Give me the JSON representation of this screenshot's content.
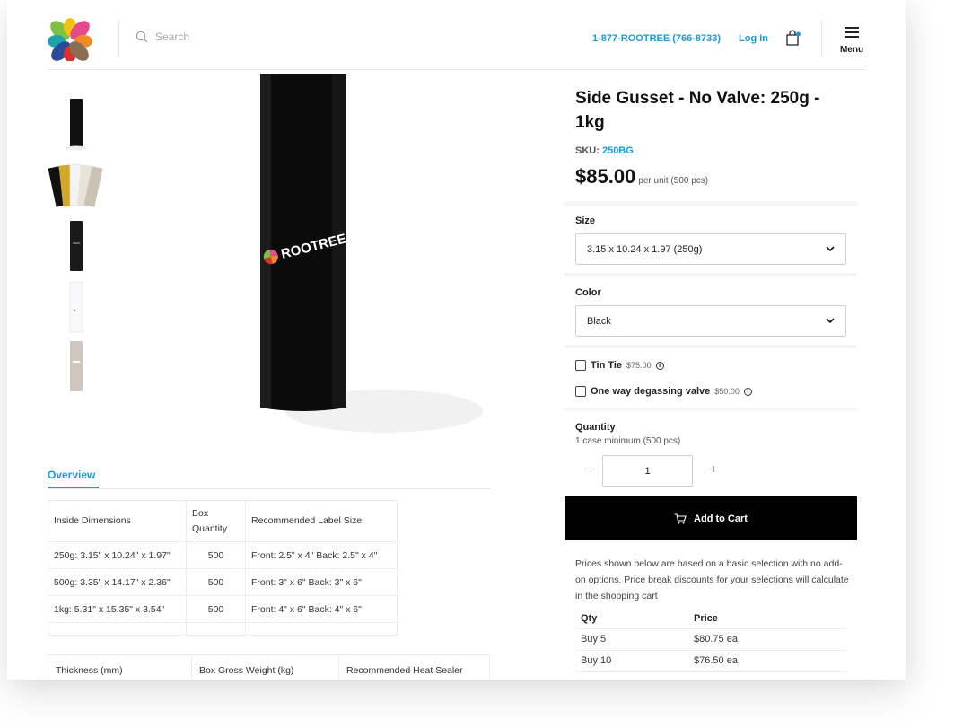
{
  "header": {
    "search_placeholder": "Search",
    "phone": "1-877-ROOTREE (766-8733)",
    "login": "Log In",
    "menu_label": "Menu"
  },
  "product": {
    "brand_on_bag": "ROOTREE",
    "title": "Side Gusset - No Valve: 250g - 1kg",
    "sku_label": "SKU:",
    "sku": "250BG",
    "price": "$85.00",
    "price_unit": "per unit (500 pcs)",
    "size_label": "Size",
    "size_value": "3.15 x 10.24 x 1.97 (250g)",
    "color_label": "Color",
    "color_value": "Black",
    "addons": [
      {
        "name": "Tin Tie",
        "price": "$75.00",
        "checked": false
      },
      {
        "name": "One way degassing valve",
        "price": "$50.00",
        "checked": false
      }
    ],
    "quantity_label": "Quantity",
    "quantity_note": "1 case minimum (500 pcs)",
    "quantity_value": "1",
    "add_to_cart": "Add to Cart",
    "price_note": "Prices shown below are based on a basic selection with no add-on options. Price break discounts for your selections will calculate in the shopping cart",
    "price_breaks": {
      "headers": [
        "Qty",
        "Price"
      ],
      "rows": [
        [
          "Buy 5",
          "$80.75 ea"
        ],
        [
          "Buy 10",
          "$76.50 ea"
        ]
      ]
    }
  },
  "overview": {
    "tab_label": "Overview",
    "spec_table": {
      "headers": [
        "Inside Dimensions",
        "Box Quantity",
        "Recommended Label Size"
      ],
      "rows": [
        [
          "250g: 3.15\" x 10.24\" x 1.97\"",
          "500",
          "Front: 2.5\" x 4\" Back: 2.5\" x 4\""
        ],
        [
          "500g: 3.35\" x 14.17\" x 2.36\"",
          "500",
          "Front: 3\" x 6\" Back: 3\" x 6\""
        ],
        [
          "1kg: 5.31\" x 15.35\" x 3.54\"",
          "500",
          "Front: 4\" x 6\" Back: 4\" x 6\""
        ]
      ]
    },
    "spec_table2": {
      "headers": [
        "Thickness (mm)",
        "Box Gross Weight (kg)",
        "Recommended Heat Sealer"
      ]
    }
  },
  "colors": {
    "accent": "#1b9bd6",
    "cart_button": "#000000",
    "panel_bg": "#f5f5f5"
  },
  "icons": {
    "search": "search-icon",
    "bag": "shopping-bag-icon",
    "menu": "hamburger-menu-icon",
    "chevron": "chevron-down-icon",
    "info": "info-icon",
    "cart": "cart-icon"
  }
}
